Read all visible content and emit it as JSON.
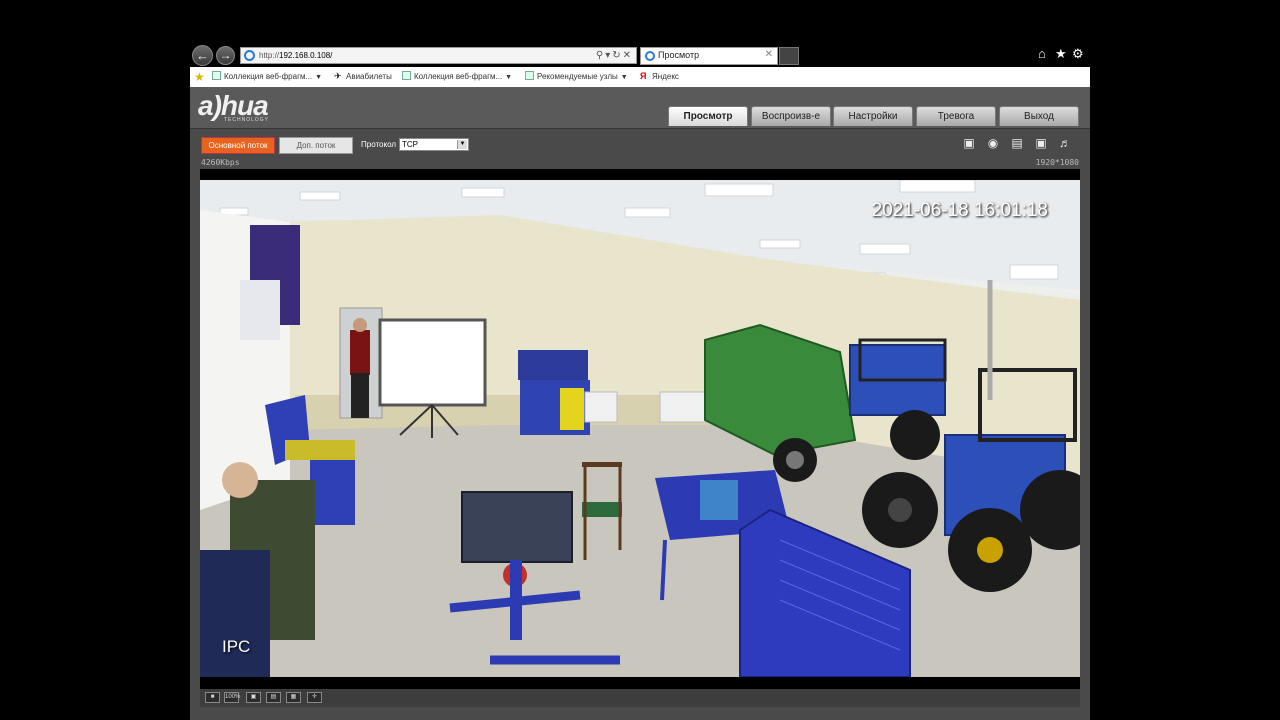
{
  "browser": {
    "url_prefix": "http://",
    "url_host": "192.168.0.108/",
    "tab_title": "Просмотр",
    "favorites": [
      {
        "label": "Коллекция веб-фрагм...",
        "has_dropdown": true
      },
      {
        "label": "Авиабилеты",
        "has_dropdown": false
      },
      {
        "label": "Коллекция веб-фрагм...",
        "has_dropdown": true
      },
      {
        "label": "Рекомендуемые узлы",
        "has_dropdown": true
      },
      {
        "label": "Яндекс",
        "has_dropdown": false
      }
    ]
  },
  "app": {
    "logo_text": "a)hua",
    "logo_sub": "TECHNOLOGY",
    "nav_tabs": [
      {
        "label": "Просмотр",
        "active": true
      },
      {
        "label": "Воспроизв-е",
        "active": false
      },
      {
        "label": "Настройки",
        "active": false
      },
      {
        "label": "Тревога",
        "active": false
      },
      {
        "label": "Выход",
        "active": false
      }
    ],
    "main_stream_label": "Основной поток",
    "sub_stream_label": "Доп. поток",
    "protocol_label": "Протокол",
    "protocol_value": "TCP",
    "bitrate": "4260Kbps",
    "resolution": "1920*1080",
    "video": {
      "timestamp": "2021-06-18 16:01:18",
      "channel_name": "IPC"
    },
    "bottom_bar": {
      "zoom_label": "100%"
    }
  },
  "colors": {
    "main_stream_active": "#e8641e",
    "app_background": "#4a4a4a",
    "tractor_blue": "#2c4fb8",
    "baler_green": "#3a8a3c"
  }
}
